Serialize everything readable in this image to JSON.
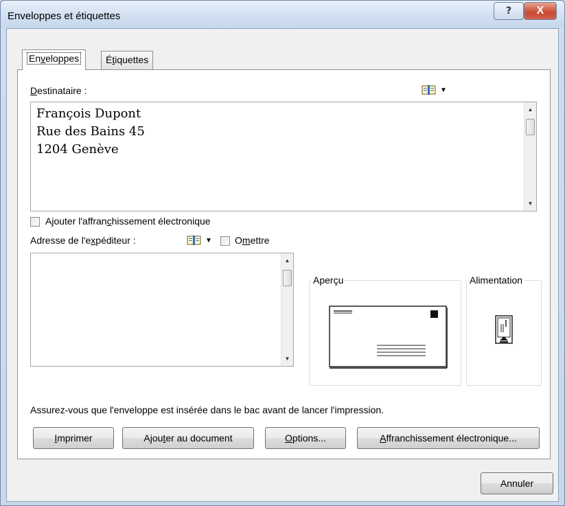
{
  "window": {
    "title": "Enveloppes et étiquettes",
    "help_label": "?",
    "close_label": "X"
  },
  "tabs": [
    {
      "pre": "En",
      "u": "v",
      "post": "eloppes"
    },
    {
      "pre": "É",
      "u": "t",
      "post": "iquettes"
    }
  ],
  "recipient": {
    "label_u": "D",
    "label_rest": "estinataire :",
    "lines": [
      "François Dupont",
      "Rue des Bains 45",
      "1204 Genève"
    ]
  },
  "epostage": {
    "pre": "Ajouter l'affran",
    "u": "c",
    "post": "hissement électronique"
  },
  "sender": {
    "pre": "Adresse de l'e",
    "u": "x",
    "post": "péditeur :",
    "omit_pre": "O",
    "omit_u": "m",
    "omit_post": "ettre",
    "value": ""
  },
  "preview": {
    "title": "Aperçu"
  },
  "feed": {
    "title": "Alimentation"
  },
  "notice": "Assurez-vous que l'enveloppe est insérée dans le bac avant de lancer l'impression.",
  "buttons": {
    "print": {
      "u": "I",
      "post": "mprimer"
    },
    "add": {
      "pre": "Ajou",
      "u": "t",
      "post": "er au document"
    },
    "options": {
      "u": "O",
      "post": "ptions..."
    },
    "epostage": {
      "u": "A",
      "post": "ffranchissement électronique..."
    },
    "cancel": "Annuler"
  },
  "icons": {
    "address_book": "address-book-icon",
    "dropdown": "chevron-down-icon",
    "scroll_up": "scroll-up-arrow-icon",
    "scroll_down": "scroll-down-arrow-icon",
    "envelope_preview": "envelope-preview-icon",
    "feed_method": "envelope-feed-icon"
  }
}
